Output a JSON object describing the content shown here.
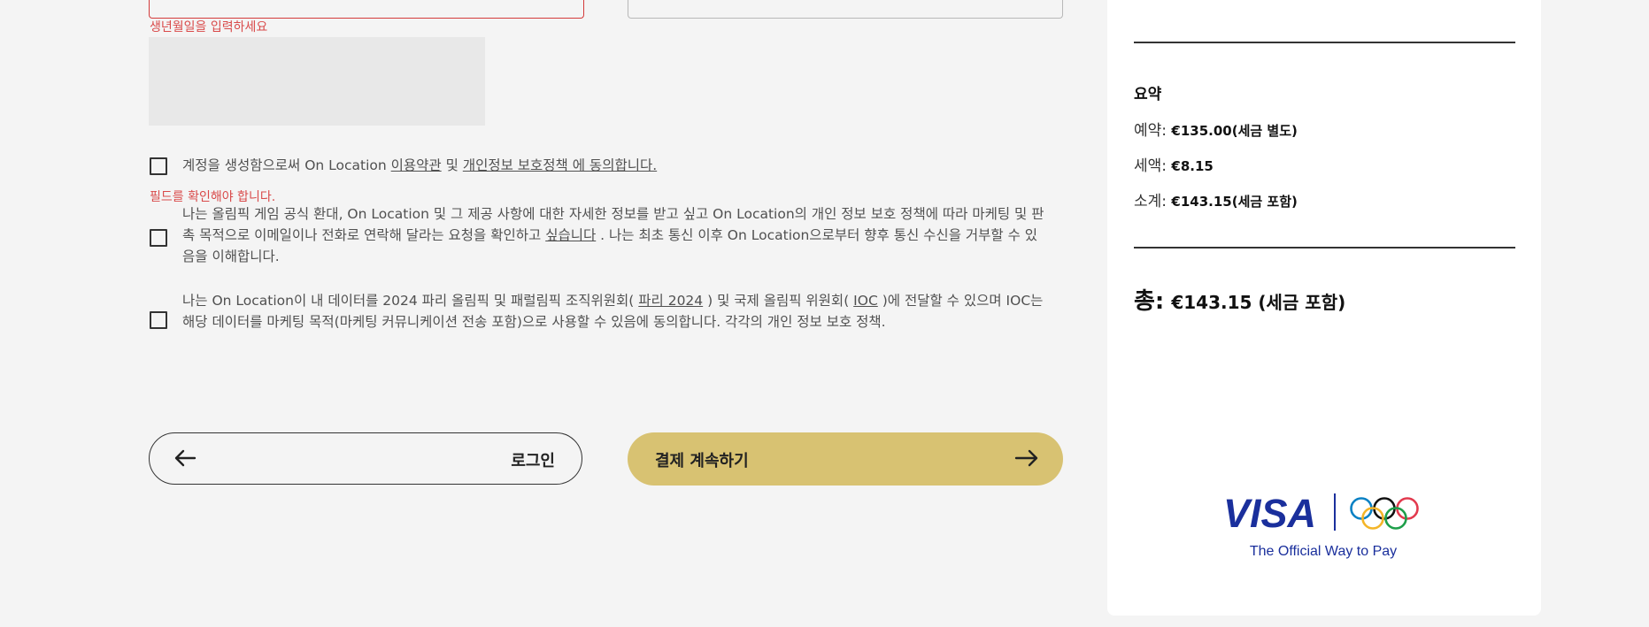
{
  "form": {
    "date_error": "생년월일을 입력하세요",
    "field_error": "필드를 확인해야 합니다.",
    "consent_terms": {
      "before": "계정을 생성함으로써 On Location ",
      "link1": "이용약관",
      "mid": " 및 ",
      "link2": "개인정보 보호정책 에 동의합니다."
    },
    "consent_marketing": {
      "before": "나는 올림픽 게임 공식 환대, On Location 및 그 제공 사항에 대한 자세한 정보를 받고 싶고 On Location의 개인 정보 보호 정책에 따라 마케팅 및 판촉 목적으로 이메일이나 전화로 연락해 달라는 요청을 확인하고 ",
      "link": "싶습니다",
      "after": " . 나는 최초 통신 이후 On Location으로부터 향후 통신 수신을 거부할 수 있음을 이해합니다."
    },
    "consent_data": {
      "before": "나는 On Location이 내 데이터를 2024 파리 올림픽 및 패럴림픽 조직위원회( ",
      "link1": "파리 2024",
      "mid": " ) 및 국제 올림픽 위원회( ",
      "link2": "IOC",
      "after": " )에 전달할 수 있으며 IOC는 해당 데이터를 마케팅 목적(마케팅 커뮤니케이션 전송 포함)으로 사용할 수 있음에 동의합니다. 각각의 개인 정보 보호 정책."
    }
  },
  "buttons": {
    "login": "로그인",
    "continue_payment": "결제 계속하기"
  },
  "summary": {
    "heading": "요약",
    "reservation_label": "예약: ",
    "reservation_value": "€135.00(세금 별도)",
    "tax_label": "세액: ",
    "tax_value": "€8.15",
    "subtotal_label": "소계: ",
    "subtotal_value": "€143.15(세금 포함)",
    "total_label": "총:",
    "total_value": "€143.15 (세금 포함)"
  },
  "branding": {
    "visa": "VISA",
    "tagline": "The Official Way to Pay",
    "visa_color": "#1a2f9c",
    "ring_colors": [
      "#0a81c4",
      "#111111",
      "#e23a4e",
      "#f4b528",
      "#1e9f4a"
    ]
  }
}
